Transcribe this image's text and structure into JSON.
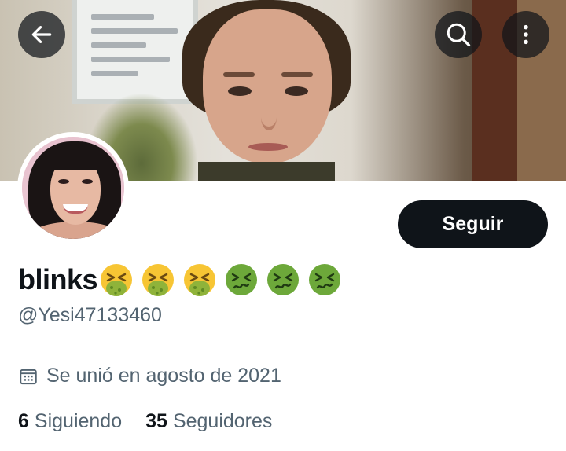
{
  "header": {
    "back_icon": "arrow-left-icon",
    "search_icon": "search-icon",
    "more_icon": "more-vertical-icon"
  },
  "profile": {
    "display_name": "blinks",
    "name_emojis": [
      "face-vomiting",
      "face-vomiting",
      "face-vomiting",
      "nauseated-face",
      "nauseated-face",
      "nauseated-face"
    ],
    "handle": "@Yesi47133460",
    "joined": "Se unió en agosto de 2021",
    "joined_icon": "calendar-icon"
  },
  "follow_button": {
    "label": "Seguir"
  },
  "stats": {
    "following_count": "6",
    "following_label": "Siguiendo",
    "followers_count": "35",
    "followers_label": "Seguidores"
  },
  "colors": {
    "primary_text": "#0f1419",
    "secondary_text": "#536471",
    "button_bg": "#0f1419",
    "button_text": "#ffffff"
  }
}
